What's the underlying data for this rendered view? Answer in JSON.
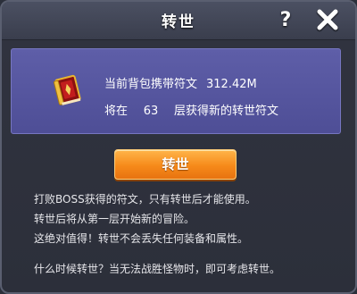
{
  "dialog": {
    "title": "转世",
    "help_label": "?",
    "close_icon": "close-x-icon"
  },
  "info": {
    "icon": "red-book-icon",
    "carried_label": "当前背包携带符文",
    "carried_value": "312.42M",
    "will_prefix": "将在",
    "layer_value": "63",
    "will_suffix": "层获得新的转世符文"
  },
  "action": {
    "rebirth_label": "转世",
    "button_color": "#f68a1a"
  },
  "description": {
    "line1": "打败BOSS获得的符文，只有转世后才能使用。",
    "line2": "转世后将从第一层开始新的冒险。",
    "line3": "这绝对值得！转世不会丢失任何装备和属性。",
    "line4": "什么时候转世？当无法战胜怪物时，即可考虑转世。"
  },
  "colors": {
    "panel": "#5a5aa4",
    "background": "#2c2f3a",
    "accent": "#f68a1a"
  }
}
